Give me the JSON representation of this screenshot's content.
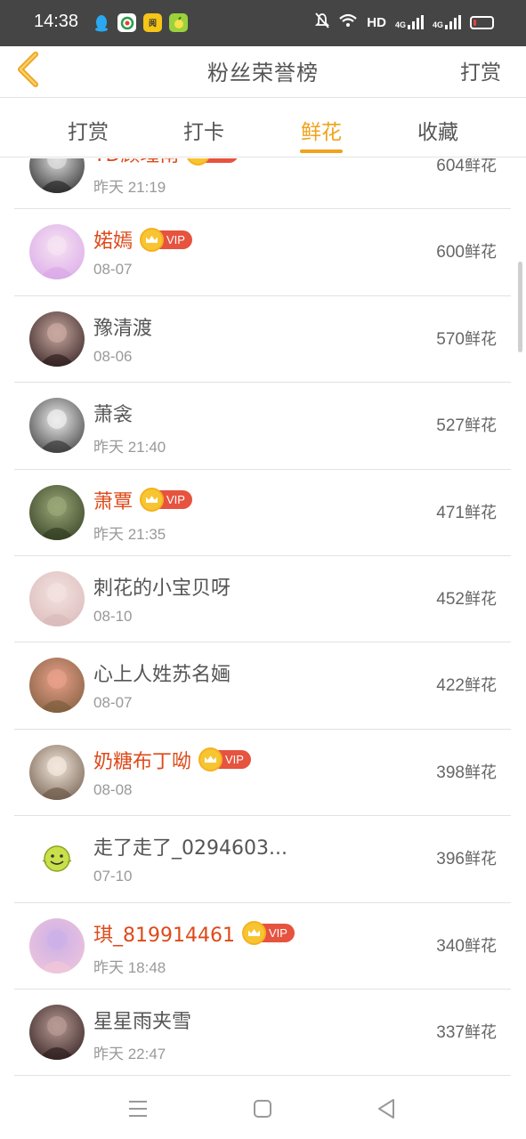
{
  "status_bar": {
    "time": "14:38",
    "network_label": "HD",
    "signal_1_label": "4G",
    "signal_2_label": "4G",
    "icons": [
      "qq-icon",
      "browser-icon",
      "reader-icon",
      "lemon-icon",
      "mute-bell-icon",
      "wifi-icon",
      "signal-icon",
      "battery-icon"
    ],
    "app_reader_label": "阅"
  },
  "header": {
    "title": "粉丝荣誉榜",
    "action": "打赏",
    "back_icon": "chevron-left-icon",
    "accent_color": "#f0a21b"
  },
  "tabs": [
    {
      "label": "打赏",
      "active": false
    },
    {
      "label": "打卡",
      "active": false
    },
    {
      "label": "鲜花",
      "active": true
    },
    {
      "label": "收藏",
      "active": false
    }
  ],
  "unit": "鲜花",
  "vip_label": "VIP",
  "fans": [
    {
      "name": "TD顾瑾南",
      "vip": true,
      "date": "昨天 21:19",
      "count": "604"
    },
    {
      "name": "婼嫣",
      "vip": true,
      "date": "08-07",
      "count": "600"
    },
    {
      "name": "豫清渡",
      "vip": false,
      "date": "08-06",
      "count": "570"
    },
    {
      "name": "萧衾",
      "vip": false,
      "date": "昨天 21:40",
      "count": "527"
    },
    {
      "name": "萧覃",
      "vip": true,
      "date": "昨天 21:35",
      "count": "471"
    },
    {
      "name": "刺花的小宝贝呀",
      "vip": false,
      "date": "08-10",
      "count": "452"
    },
    {
      "name": "心上人姓苏名婳",
      "vip": false,
      "date": "08-07",
      "count": "422"
    },
    {
      "name": "奶糖布丁呦",
      "vip": true,
      "date": "08-08",
      "count": "398"
    },
    {
      "name": "走了走了_0294603...",
      "vip": false,
      "date": "07-10",
      "count": "396"
    },
    {
      "name": "琪_819914461",
      "vip": true,
      "date": "昨天 18:48",
      "count": "340"
    },
    {
      "name": "星星雨夹雪",
      "vip": false,
      "date": "昨天 22:47",
      "count": "337"
    }
  ],
  "avatar_palettes": [
    [
      "#222",
      "#ddd"
    ],
    [
      "#d9a6e8",
      "#f6e3f2"
    ],
    [
      "#2a1a1a",
      "#c9a8a0"
    ],
    [
      "#333",
      "#eee"
    ],
    [
      "#2f3a1f",
      "#9aa777"
    ],
    [
      "#d9b8b8",
      "#f3e2e0"
    ],
    [
      "#7a5a3a",
      "#e8a08a"
    ],
    [
      "#6a5645",
      "#f3e7dc"
    ],
    [
      "#ffffff",
      "#ffffff"
    ],
    [
      "#f3c7d9",
      "#cbb0e8"
    ],
    [
      "#2a1a1a",
      "#b89a94"
    ]
  ],
  "navbar": {
    "icons": [
      "menu-icon",
      "home-square-icon",
      "back-triangle-icon"
    ]
  }
}
